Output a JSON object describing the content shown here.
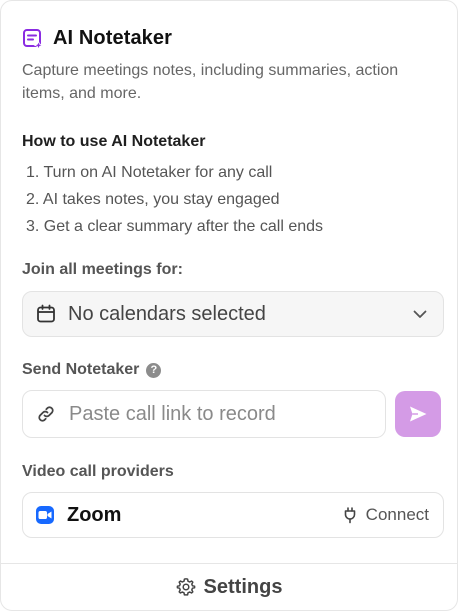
{
  "header": {
    "title": "AI Notetaker",
    "subtitle": "Capture meetings notes, including summaries, action items, and more.",
    "icon": "notes-sparkle-icon",
    "accent_color": "#8a2be2"
  },
  "how_to": {
    "title": "How to use AI Notetaker",
    "steps": [
      "1. Turn on AI Notetaker for any call",
      "2. AI takes notes, you stay engaged",
      "3. Get a clear summary after the call ends"
    ]
  },
  "join": {
    "label": "Join all meetings for:",
    "selected_value": "No calendars selected",
    "icon": "calendar-icon"
  },
  "send": {
    "label": "Send Notetaker",
    "help_glyph": "?",
    "placeholder": "Paste call link to record",
    "value": "",
    "button_color": "#d49be6"
  },
  "providers": {
    "label": "Video call providers",
    "items": [
      {
        "name": "Zoom",
        "action": "Connect",
        "brand_color": "#1769ff"
      }
    ]
  },
  "footer": {
    "settings_label": "Settings"
  }
}
